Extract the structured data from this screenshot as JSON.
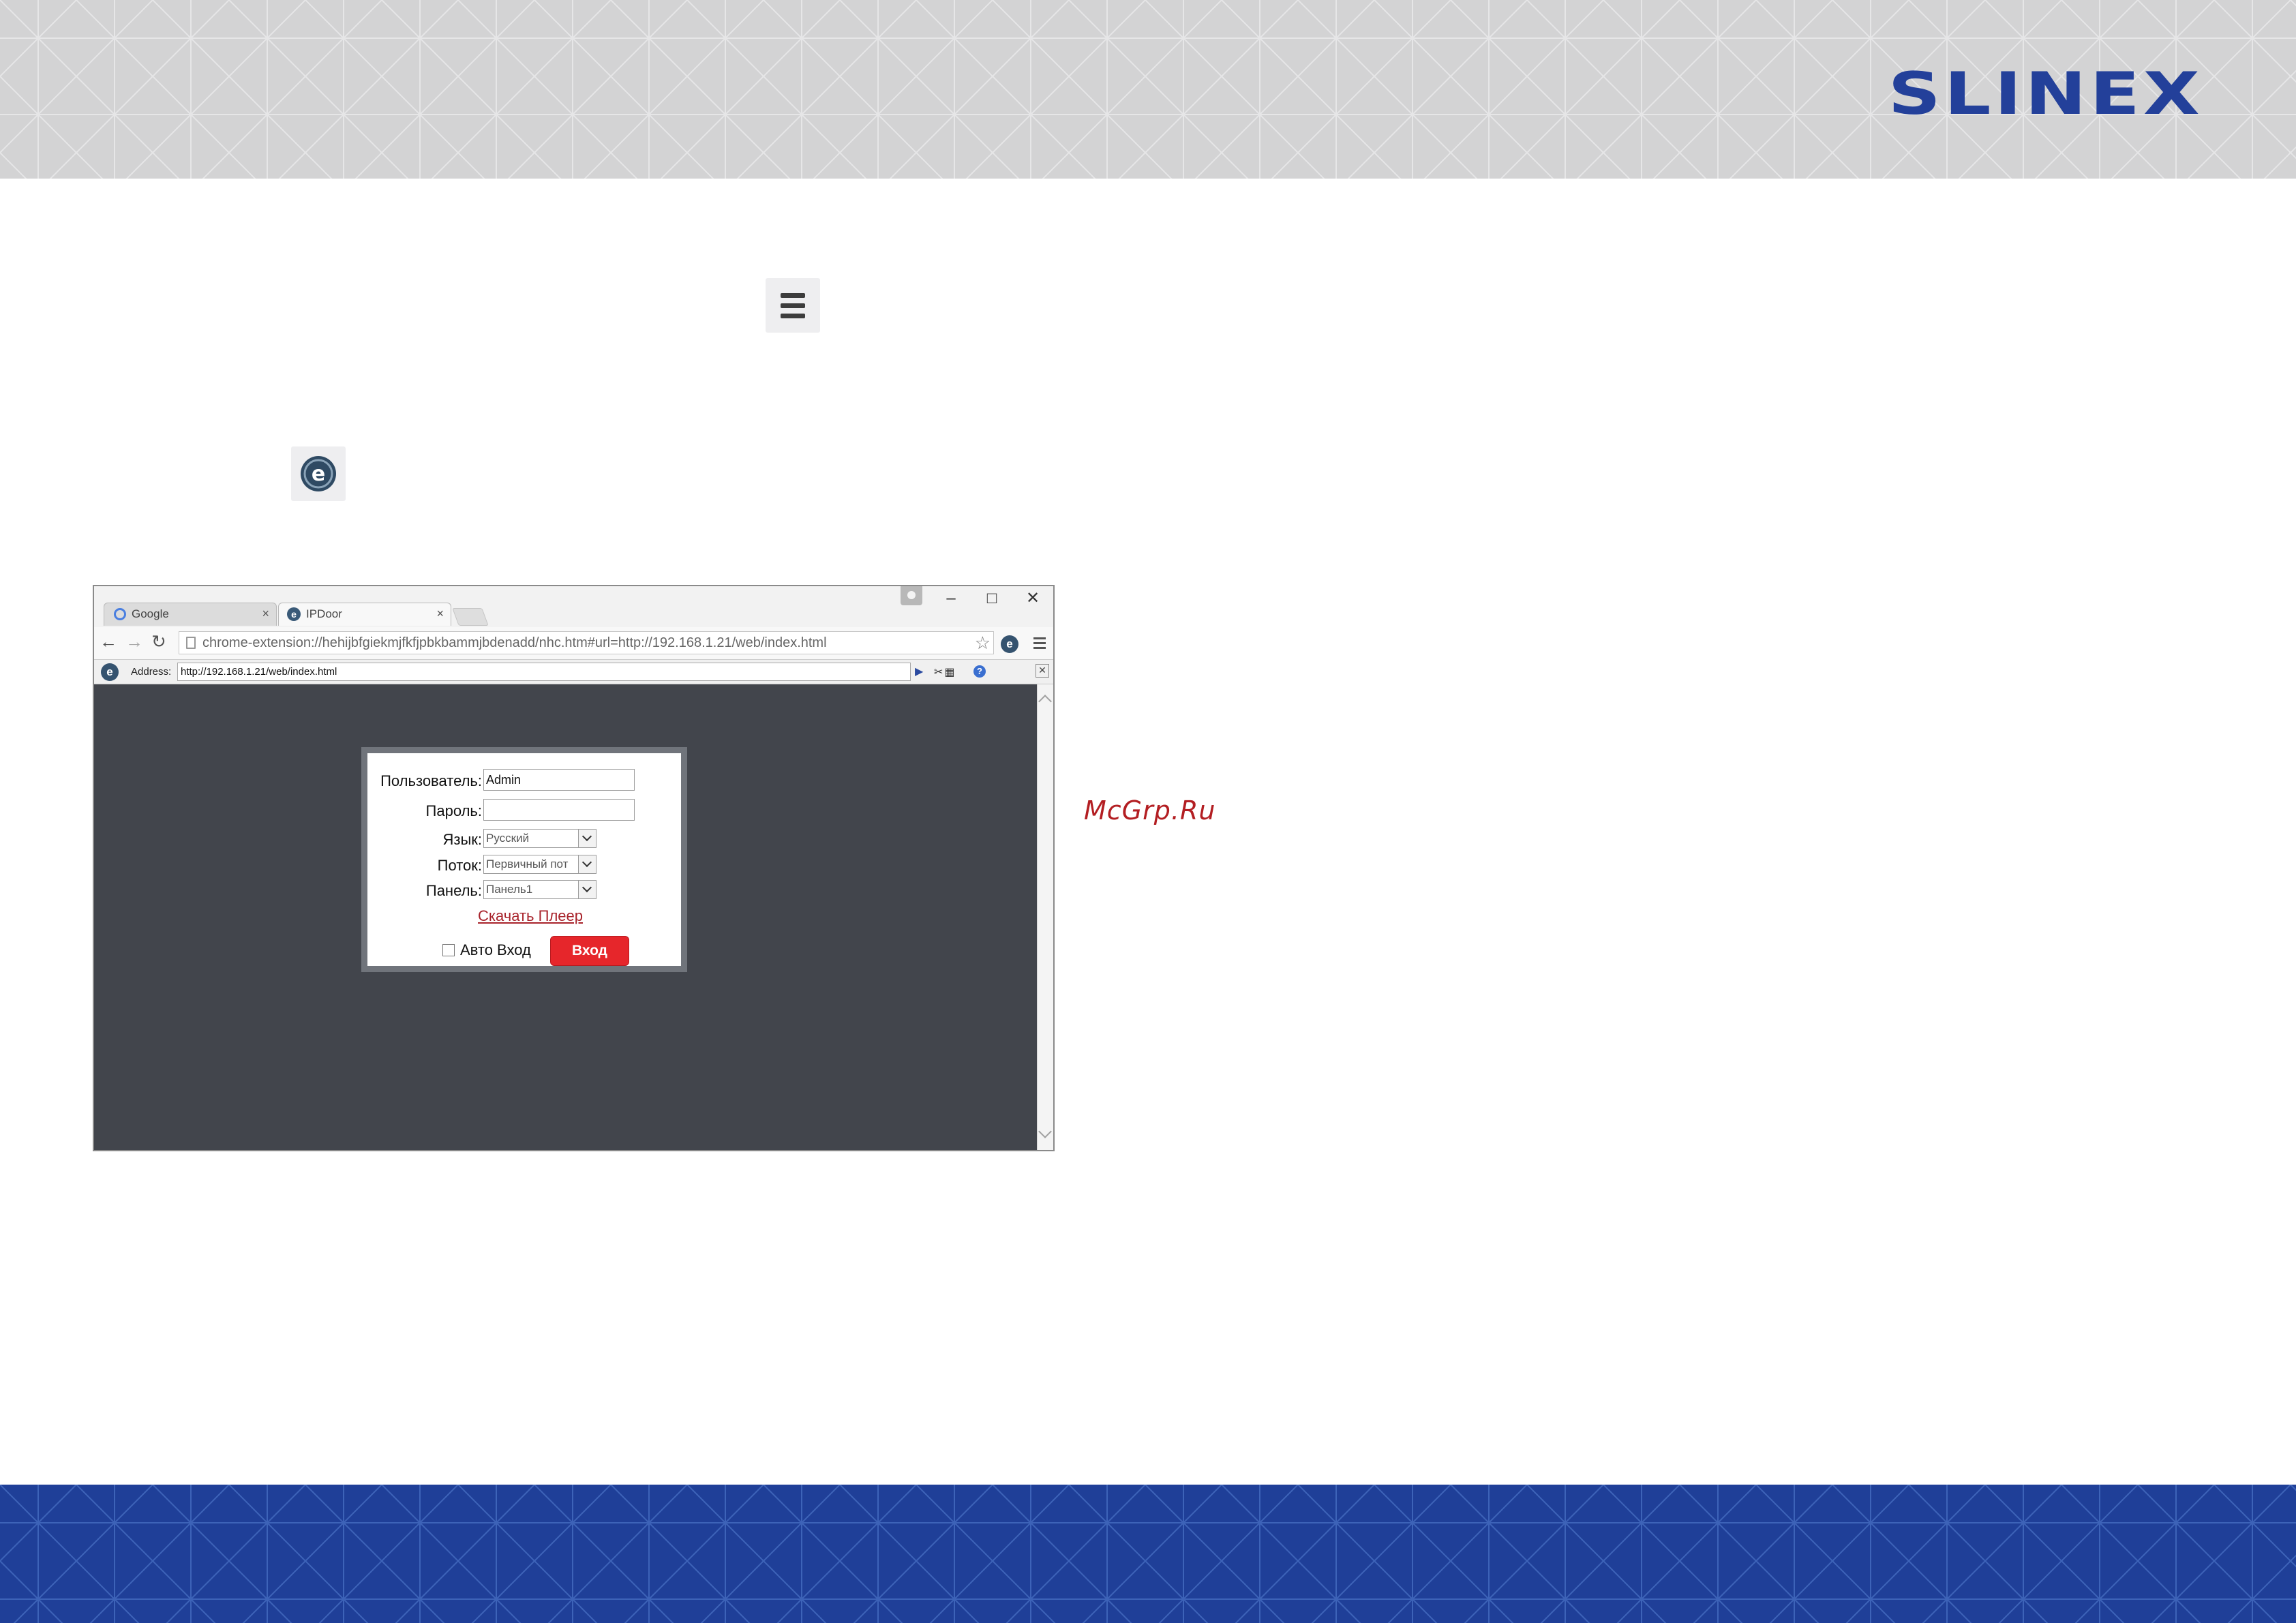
{
  "brand": {
    "logo_text": "SLINEX",
    "header_color": "#d3d3d4",
    "footer_color": "#1f3f98",
    "logo_color": "#23409a"
  },
  "icons": {
    "menu_tile": "hamburger-menu-icon",
    "extension_tile": "ie-tab-extension-icon"
  },
  "browser": {
    "tabs": [
      {
        "label": "Google",
        "icon": "google-icon"
      },
      {
        "label": "IPDoor",
        "icon": "ie-tab-icon"
      }
    ],
    "tab_close": "×",
    "window_controls": {
      "minimize": "–",
      "maximize": "□",
      "close": "✕"
    },
    "url": "chrome-extension://hehijbfgiekmjfkfjpbkbammjbdenadd/nhc.htm#url=http://192.168.1.21/web/index.html",
    "ie_address_label": "Address:",
    "ie_address_value": "http://192.168.1.21/web/index.html",
    "ie_close": "✕"
  },
  "login": {
    "user_label": "Пользователь:",
    "user_value": "Admin",
    "password_label": "Пароль:",
    "password_value": "",
    "language_label": "Язык:",
    "language_value": "Русский",
    "stream_label": "Поток:",
    "stream_value": "Первичный пот",
    "panel_label": "Панель:",
    "panel_value": "Панель1",
    "download_link": "Скачать Плеер",
    "auto_login_label": "Авто Вход",
    "login_button": "Вход",
    "button_color": "#e6262b"
  },
  "watermark": "McGrp.Ru"
}
